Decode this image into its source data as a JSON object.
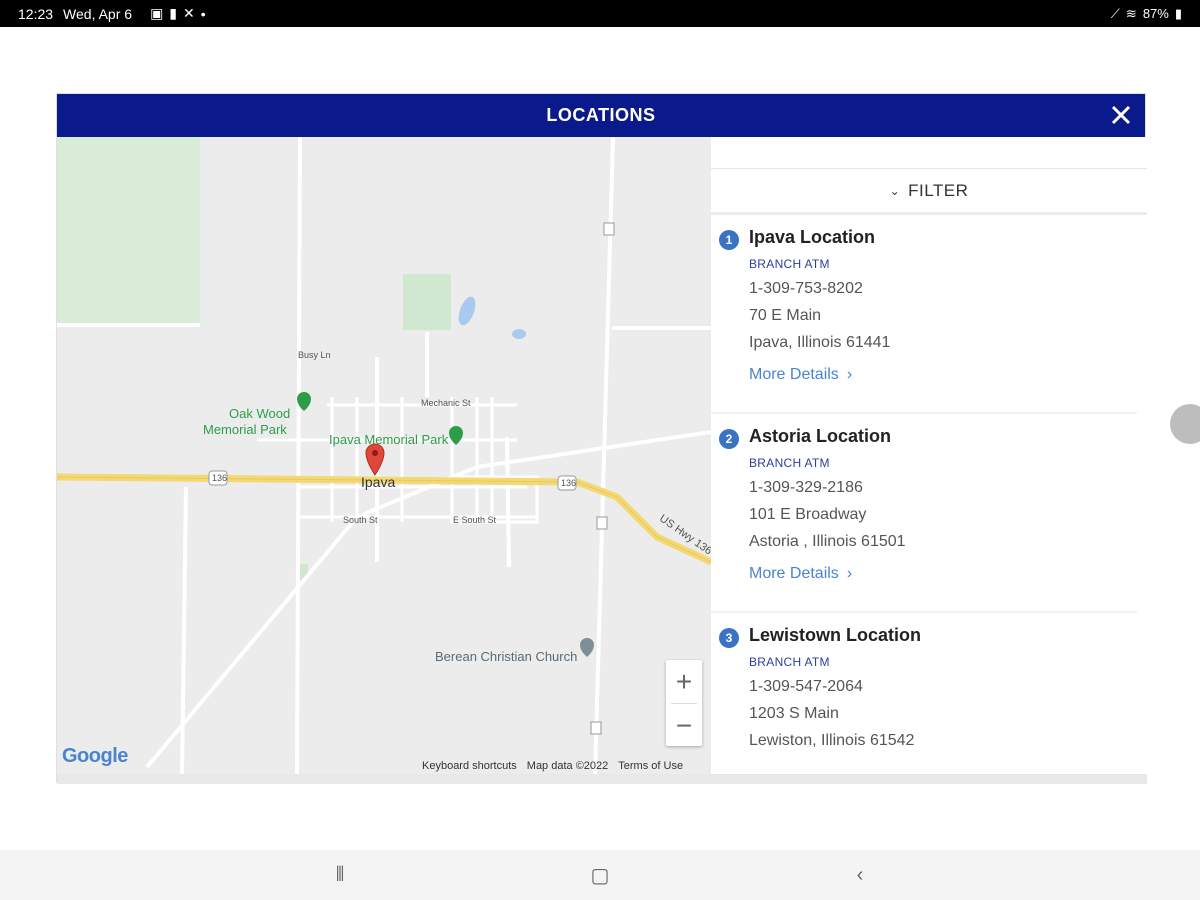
{
  "status_bar": {
    "time": "12:23",
    "date": "Wed, Apr 6",
    "battery": "87%"
  },
  "modal": {
    "title": "LOCATIONS",
    "close_icon": "close-icon"
  },
  "map": {
    "labels": {
      "oak_wood": "Oak Wood",
      "memorial_park": "Memorial Park",
      "ipava_memorial_park": "Ipava Memorial Park",
      "ipava": "Ipava",
      "mechanic_st": "Mechanic St",
      "south_st": "South St",
      "e_south_st": "E South St",
      "busy_ln": "Busy Ln",
      "berean_church": "Berean Christian Church",
      "us_hwy": "US Hwy 136",
      "hwy_136_a": "136",
      "hwy_136_b": "136"
    },
    "zoom_in": "+",
    "zoom_out": "−",
    "google_logo": "Google",
    "footer": {
      "shortcuts": "Keyboard shortcuts",
      "map_data": "Map data ©2022",
      "terms": "Terms of Use"
    }
  },
  "panel": {
    "filter_label": "FILTER",
    "locations": [
      {
        "num": "1",
        "name": "Ipava Location",
        "type": "BRANCH ATM",
        "phone": "1-309-753-8202",
        "address": "70 E Main",
        "city": "Ipava, Illinois 61441",
        "more": "More Details"
      },
      {
        "num": "2",
        "name": "Astoria Location",
        "type": "BRANCH ATM",
        "phone": "1-309-329-2186",
        "address": "101 E Broadway",
        "city": "Astoria , Illinois 61501",
        "more": "More Details"
      },
      {
        "num": "3",
        "name": "Lewistown Location",
        "type": "BRANCH ATM",
        "phone": "1-309-547-2064",
        "address": "1203 S Main",
        "city": "Lewiston, Illinois 61542"
      }
    ]
  },
  "colors": {
    "header_bg": "#0a1a8c",
    "accent_blue": "#3b73c4",
    "link_blue": "#4a84cf",
    "park_green": "#2e9d4a",
    "highway_yellow": "#f3d873"
  }
}
